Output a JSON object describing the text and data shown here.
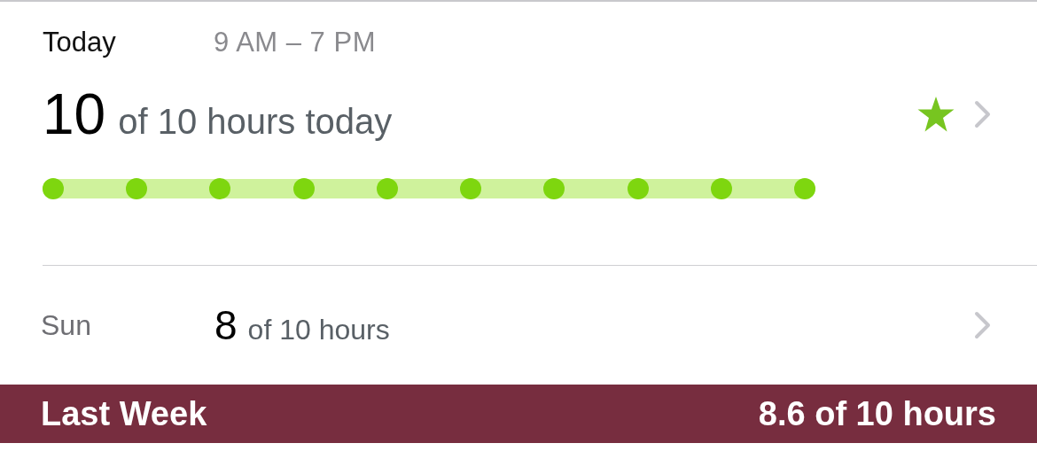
{
  "today": {
    "label": "Today",
    "time_range": "9 AM – 7 PM",
    "count": "10",
    "summary": "of 10 hours today",
    "goal_met": true,
    "hours": [
      {
        "achieved": true
      },
      {
        "achieved": true
      },
      {
        "achieved": true
      },
      {
        "achieved": true
      },
      {
        "achieved": true
      },
      {
        "achieved": true
      },
      {
        "achieved": true
      },
      {
        "achieved": true
      },
      {
        "achieved": true
      },
      {
        "achieved": true
      }
    ]
  },
  "days": [
    {
      "day": "Sun",
      "count": "8",
      "summary": "of 10 hours"
    }
  ],
  "footer": {
    "label": "Last Week",
    "value": "8.6 of 10 hours"
  }
}
